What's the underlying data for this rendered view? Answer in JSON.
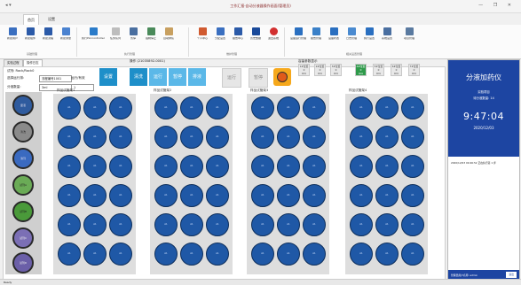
{
  "window": {
    "title": "工作汇报-自动分液器操作画面(管理员)",
    "quick_access": "◂ ▾",
    "controls": "— ❐ ✕"
  },
  "tabs": [
    {
      "label": "首页"
    },
    {
      "label": "设置"
    }
  ],
  "ribbon": {
    "groups": [
      {
        "label": "基础管理",
        "items": [
          "新建用户",
          "新建组件",
          "新建流程",
          "新建测量"
        ]
      },
      {
        "label": "执行管理",
        "items": [
          "执行PLCcontroller",
          "任务队列",
          "暂停",
          "强制停止",
          "自动排队"
        ]
      },
      {
        "label": "维护管理",
        "items": [
          "个人中心",
          "分配设置",
          "报告中心",
          "历史数据",
          "退出系统"
        ]
      },
      {
        "label": "相关设置管理",
        "items": [
          "设备运行管理",
          "报告管理",
          "设备状态",
          "日志管理",
          "执行设置",
          "系统设置",
          "项目管理"
        ]
      }
    ]
  },
  "doc_tabs": [
    {
      "label": "实验过程"
    },
    {
      "label": "操作日志"
    }
  ],
  "controls": {
    "protocol_label": "试剂: Rack/Rack0",
    "select_label": "选择运行排:",
    "select_value": "流程编号1001",
    "select_suffix": "运行/有效",
    "count_label": "分液数量:",
    "count_value": "3ml",
    "count_value2": "1",
    "action_title": "操作 (21035892-0001)",
    "status_title": "容量参数显示"
  },
  "buttons": {
    "start": "设置",
    "b1": "清洗",
    "b2": "运行",
    "b3": "暂停",
    "b4": "排液",
    "pause": "运行",
    "stop": "暂停"
  },
  "status_minis": [
    {
      "top": "1#位置",
      "mid": "0",
      "bot": "0ml"
    },
    {
      "top": "2#位置",
      "mid": "0",
      "bot": "0ml"
    },
    {
      "top": "3#位置",
      "mid": "0",
      "bot": "0ml"
    },
    {
      "top": "4#位置",
      "mid": "0",
      "bot": "0ml"
    },
    {
      "top": "5#位置",
      "mid": "0",
      "bot": "0ml"
    },
    {
      "top": "6#位置",
      "mid": "0",
      "bot": "0ml"
    },
    {
      "top": "7#位置",
      "mid": "0",
      "bot": "0ml"
    }
  ],
  "panels": [
    {
      "title": "样品试管架1"
    },
    {
      "title": "样品试管架2"
    },
    {
      "title": "样品试管架3"
    },
    {
      "title": "样品试管架4"
    }
  ],
  "left_column": [
    "废液",
    "清洗",
    "溶剂",
    "试剂A",
    "试剂B",
    "试剂C",
    "试剂D"
  ],
  "cell_label": "A1",
  "right_panel": {
    "title": "分液加药仪",
    "subtitle": "实验项目",
    "info": "待分液数量: 14",
    "time": "9:47:04",
    "date": "2020/12/03",
    "log_line": "2020/12/03 09:46:52 正在执行第 1 步",
    "footer_text": "管理员用户名称: admin",
    "footer_button": "退出"
  },
  "statusbar": {
    "text": "Ready"
  },
  "colors": {
    "accent": "#1d45a2",
    "button_teal": "#1e8fc9",
    "cell": "#1f58a6"
  }
}
